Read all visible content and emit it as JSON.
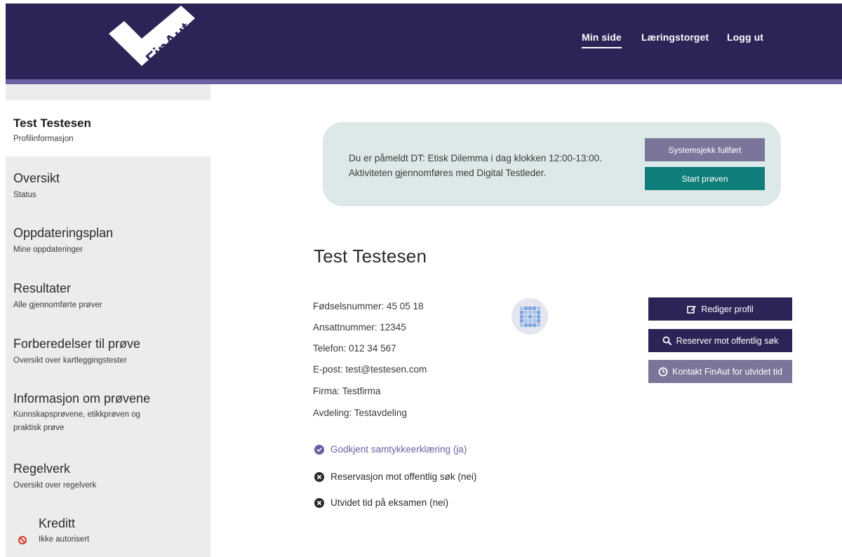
{
  "header": {
    "logo_text": "FinAut",
    "nav": [
      {
        "label": "Min side",
        "active": true
      },
      {
        "label": "Læringstorget",
        "active": false
      },
      {
        "label": "Logg ut",
        "active": false
      }
    ]
  },
  "colors": {
    "brand_dark": "#2b2456",
    "brand_accent": "#6c5fa0",
    "teal": "#0f7e7a",
    "muted_button": "#7a7699",
    "banner_bg": "#dde9e8",
    "error_red": "#d9342b"
  },
  "sidebar": {
    "items": [
      {
        "title": "Test Testesen",
        "subtitle": "Profilinformasjon",
        "active": true
      },
      {
        "title": "Oversikt",
        "subtitle": "Status"
      },
      {
        "title": "Oppdateringsplan",
        "subtitle": "Mine oppdateringer"
      },
      {
        "title": "Resultater",
        "subtitle": "Alle gjennomførte prøver"
      },
      {
        "title": "Forberedelser til prøve",
        "subtitle": "Oversikt over kartleggingstester"
      },
      {
        "title": "Informasjon om prøvene",
        "subtitle_line1": "Kunnskapsprøvene, etikkprøven og",
        "subtitle_line2": "praktisk prøve"
      },
      {
        "title": "Regelverk",
        "subtitle": "Oversikt over regelverk"
      },
      {
        "title": "Kreditt",
        "subtitle": "Ikke autorisert",
        "icon": "forbidden-icon"
      }
    ]
  },
  "banner": {
    "line1": "Du er påmeldt DT: Etisk Dilemma i dag klokken 12:00-13:00.",
    "line2": "Aktiviteten gjennomføres med Digital Testleder.",
    "syscheck_label": "Systemsjekk fullført",
    "start_label": "Start prøven"
  },
  "profile": {
    "name": "Test Testesen",
    "info": [
      "Fødselsnummer: 45 05 18",
      "Ansattnummer: 12345",
      "Telefon: 012 34 567",
      "E-post: test@testesen.com",
      "Firma: Testfirma",
      "Avdeling: Testavdeling"
    ],
    "buttons": {
      "edit": "Rediger profil",
      "reserve": "Reserver mot offentlig søk",
      "contact": "Kontakt FinAut for utvidet tid"
    },
    "statuses": [
      {
        "label": "Godkjent samtykkeerklæring (ja)",
        "ok": true
      },
      {
        "label": "Reservasjon mot offentlig søk (nei)",
        "ok": false
      },
      {
        "label": "Utvidet tid på eksamen (nei)",
        "ok": false
      }
    ]
  }
}
